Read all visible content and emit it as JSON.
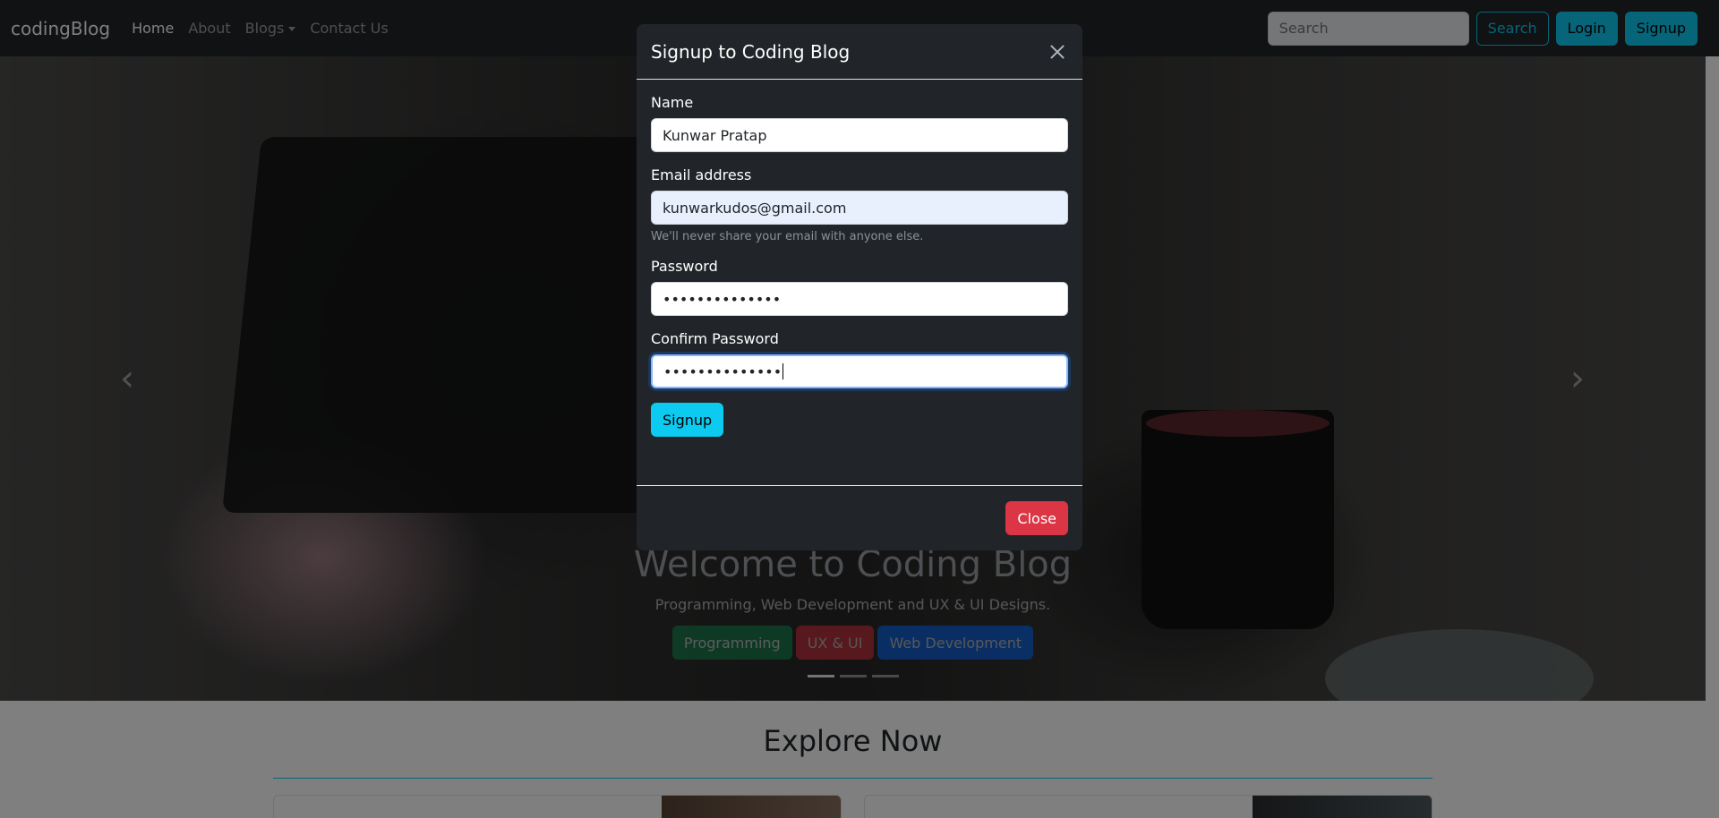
{
  "navbar": {
    "brand": "codingBlog",
    "links": [
      {
        "label": "Home"
      },
      {
        "label": "About"
      },
      {
        "label": "Blogs"
      },
      {
        "label": "Contact Us"
      }
    ],
    "search_placeholder": "Search",
    "search_button": "Search",
    "login_button": "Login",
    "signup_button": "Signup"
  },
  "hero": {
    "title": "Welcome to Coding Blog",
    "subtitle": "Programming, Web Development and UX & UI Designs.",
    "buttons": [
      {
        "label": "Programming"
      },
      {
        "label": "UX & UI"
      },
      {
        "label": "Web Development"
      }
    ],
    "active_slide": 1,
    "slide_count": 3
  },
  "explore": {
    "heading": "Explore Now"
  },
  "modal": {
    "title": "Signup to Coding Blog",
    "fields": {
      "name": {
        "label": "Name",
        "value": "Kunwar Pratap"
      },
      "email": {
        "label": "Email address",
        "value": "kunwarkudos@gmail.com",
        "help": "We'll never share your email with anyone else."
      },
      "password": {
        "label": "Password",
        "value": "••••••••••••••"
      },
      "confirm_password": {
        "label": "Confirm Password",
        "value": "••••••••••••••"
      }
    },
    "submit_button": "Signup",
    "close_button": "Close"
  },
  "colors": {
    "navbar_bg": "#212529",
    "info": "#0dcaf0",
    "danger": "#dc3545",
    "success": "#198754",
    "primary": "#0d6efd"
  }
}
